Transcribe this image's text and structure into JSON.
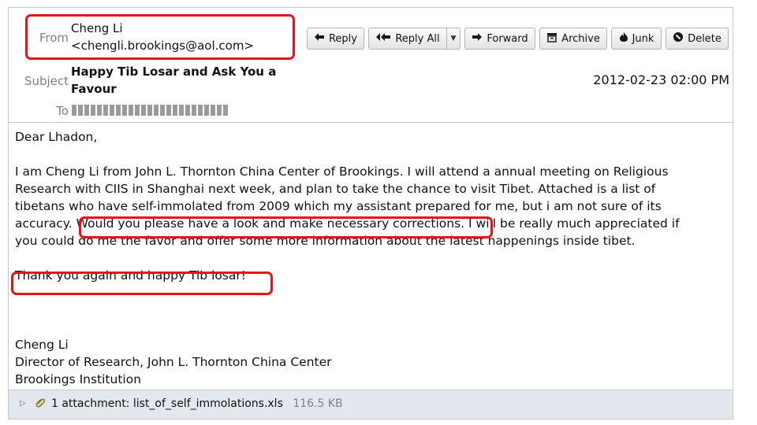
{
  "header": {
    "from_label": "From",
    "from_name": "Cheng Li",
    "from_email": "<chengli.brookings@aol.com>",
    "subject_label": "Subject",
    "subject": "Happy Tib Losar and Ask You a Favour",
    "date": "2012-02-23 02:00 PM",
    "to_label": "To"
  },
  "toolbar": {
    "reply": "Reply",
    "reply_all": "Reply All",
    "forward": "Forward",
    "archive": "Archive",
    "junk": "Junk",
    "delete": "Delete"
  },
  "body": {
    "greeting": "Dear Lhadon,",
    "para1_line1": "I am Cheng Li from John L. Thornton China Center of Brookings. I will attend a annual meeting on Religious",
    "para1_line2": "Research with CIIS in Shanghai next week, and plan to take the chance to visit Tibet. Attached is a list of",
    "para1_line3": "tibetans who have self-immolated from 2009 which my assistant prepared for me, but i am not sure of its",
    "para1_line4_pre": "accuracy.",
    "para1_line4_highlight": "Would you please have a look and make necessary corrections.",
    "para1_line4_post": "I will be really much appreciated if",
    "para1_line5": "you could do me the favor and offer some more information about the latest happenings inside tibet.",
    "thanks": "Thank you again and happy Tib losar!",
    "sig_name": "Cheng Li",
    "sig_title": "Director of Research, John L. Thornton China Center",
    "sig_org": "Brookings Institution"
  },
  "attachment": {
    "label": "1 attachment: list_of_self_immolations.xls",
    "size": "116.5 KB"
  },
  "colors": {
    "highlight": "#e8121a",
    "attachment_bar": "#e3e7ee"
  }
}
